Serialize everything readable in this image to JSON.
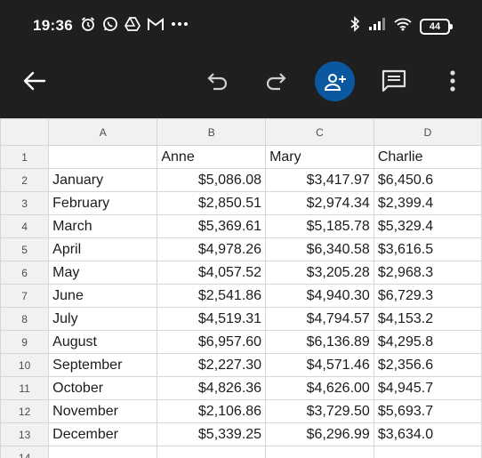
{
  "status_bar": {
    "time": "19:36",
    "battery": "44",
    "left_icons": [
      "alarm-icon",
      "whatsapp-icon",
      "drive-icon",
      "gmail-icon",
      "more-dots-icon"
    ],
    "right_icons": [
      "bluetooth-icon",
      "signal-icon",
      "wifi-icon",
      "battery-icon"
    ]
  },
  "toolbar": {
    "icons": [
      "back-arrow-icon",
      "undo-icon",
      "redo-icon",
      "add-person-icon",
      "comment-icon",
      "more-vert-icon"
    ],
    "share_color": "#0b57a0"
  },
  "sheet": {
    "column_headers": [
      "A",
      "B",
      "C",
      "D"
    ],
    "rows": [
      {
        "num": "1",
        "a": "",
        "b": "Anne",
        "c": "Mary",
        "d": "Charlie"
      },
      {
        "num": "2",
        "a": "January",
        "b": "$5,086.08",
        "c": "$3,417.97",
        "d": "$6,450.6"
      },
      {
        "num": "3",
        "a": "February",
        "b": "$2,850.51",
        "c": "$2,974.34",
        "d": "$2,399.4"
      },
      {
        "num": "4",
        "a": "March",
        "b": "$5,369.61",
        "c": "$5,185.78",
        "d": "$5,329.4"
      },
      {
        "num": "5",
        "a": "April",
        "b": "$4,978.26",
        "c": "$6,340.58",
        "d": "$3,616.5"
      },
      {
        "num": "6",
        "a": "May",
        "b": "$4,057.52",
        "c": "$3,205.28",
        "d": "$2,968.3"
      },
      {
        "num": "7",
        "a": "June",
        "b": "$2,541.86",
        "c": "$4,940.30",
        "d": "$6,729.3"
      },
      {
        "num": "8",
        "a": "July",
        "b": "$4,519.31",
        "c": "$4,794.57",
        "d": "$4,153.2"
      },
      {
        "num": "9",
        "a": "August",
        "b": "$6,957.60",
        "c": "$6,136.89",
        "d": "$4,295.8"
      },
      {
        "num": "10",
        "a": "September",
        "b": "$2,227.30",
        "c": "$4,571.46",
        "d": "$2,356.6"
      },
      {
        "num": "11",
        "a": "October",
        "b": "$4,826.36",
        "c": "$4,626.00",
        "d": "$4,945.7"
      },
      {
        "num": "12",
        "a": "November",
        "b": "$2,106.86",
        "c": "$3,729.50",
        "d": "$5,693.7"
      },
      {
        "num": "13",
        "a": "December",
        "b": "$5,339.25",
        "c": "$6,296.99",
        "d": "$3,634.0"
      },
      {
        "num": "14",
        "a": "",
        "b": "",
        "c": "",
        "d": ""
      }
    ]
  }
}
